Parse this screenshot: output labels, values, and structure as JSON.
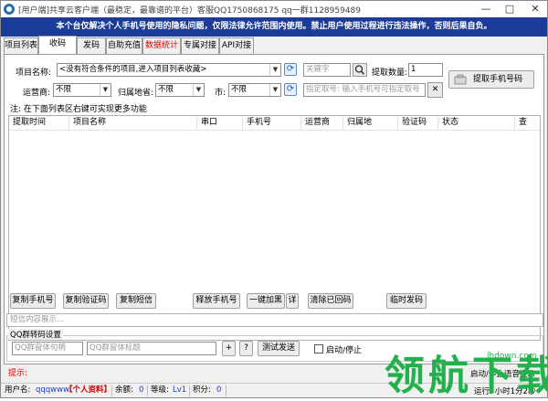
{
  "window": {
    "title": "[用户端]共享云客户端（最稳定，最靠谱的平台）客服QQ1750868175  qq一群1128959489",
    "minimize": "—",
    "maximize": "□",
    "close": "✕"
  },
  "notice": "本个台仅解决个人手机号使用的隐私问题，仅限法律允许范围内使用。禁止用户使用过程进行违法操作，否则后果自负。",
  "tabs": [
    {
      "label": "项目列表"
    },
    {
      "label": "收码"
    },
    {
      "label": "发码"
    },
    {
      "label": "自助充值"
    },
    {
      "label": "数据统计"
    },
    {
      "label": "专属对接"
    },
    {
      "label": "API对接"
    }
  ],
  "form": {
    "project_label": "项目名称:",
    "project_value": "<没有符合条件的项目,进入项目列表收藏>",
    "keyword_placeholder": "关键字",
    "qty_label": "提取数量:",
    "qty_value": "1",
    "operator_label": "运营商:",
    "operator_value": "不限",
    "province_label": "归属地省:",
    "province_value": "不限",
    "city_label": "市:",
    "city_value": "不限",
    "specify_placeholder": "指定取号: 输入手机号可指定取号",
    "clear_btn": "✕",
    "get_phone_button": "提取手机号码",
    "hint": "注: 在下面列表区右键可实现更多功能"
  },
  "table": {
    "headers": [
      "提取时间",
      "项目名称",
      "串口",
      "手机号",
      "运营商",
      "归属地",
      "验证码",
      "状态",
      "查"
    ]
  },
  "actions": {
    "copy_phone": "复制手机号",
    "copy_code": "复制验证码",
    "copy_sms": "复制短信",
    "release_phone": "释放手机号",
    "one_click_blacklist": "一键加黑",
    "detail": "详",
    "clear_received": "清除已回码",
    "timed_send": "临时发码"
  },
  "sms_placeholder": "短信内容展示...",
  "qq_group": {
    "title": "QQ群转码设置",
    "qq_number_placeholder": "QQ群窗体句柄",
    "qq_title_placeholder": "QQ群窗体标题",
    "plus": "+",
    "question": "?",
    "test_send": "测试发送",
    "start_stop": "启动/停止"
  },
  "tip": "提示:",
  "status": {
    "user_label": "用户名:",
    "user_value": "qqqwww",
    "personal_info": "【个人资料】",
    "balance_label": "余额:",
    "balance_value": "0",
    "level_label": "等级:",
    "level_value": "Lv1",
    "points_label": "积分:",
    "points_value": "0",
    "right_top": "启动/停止语音提示",
    "right_bottom": "运行: 小时1分2秒"
  },
  "watermark": {
    "big": "领航下载",
    "url": "lhdown.com"
  }
}
